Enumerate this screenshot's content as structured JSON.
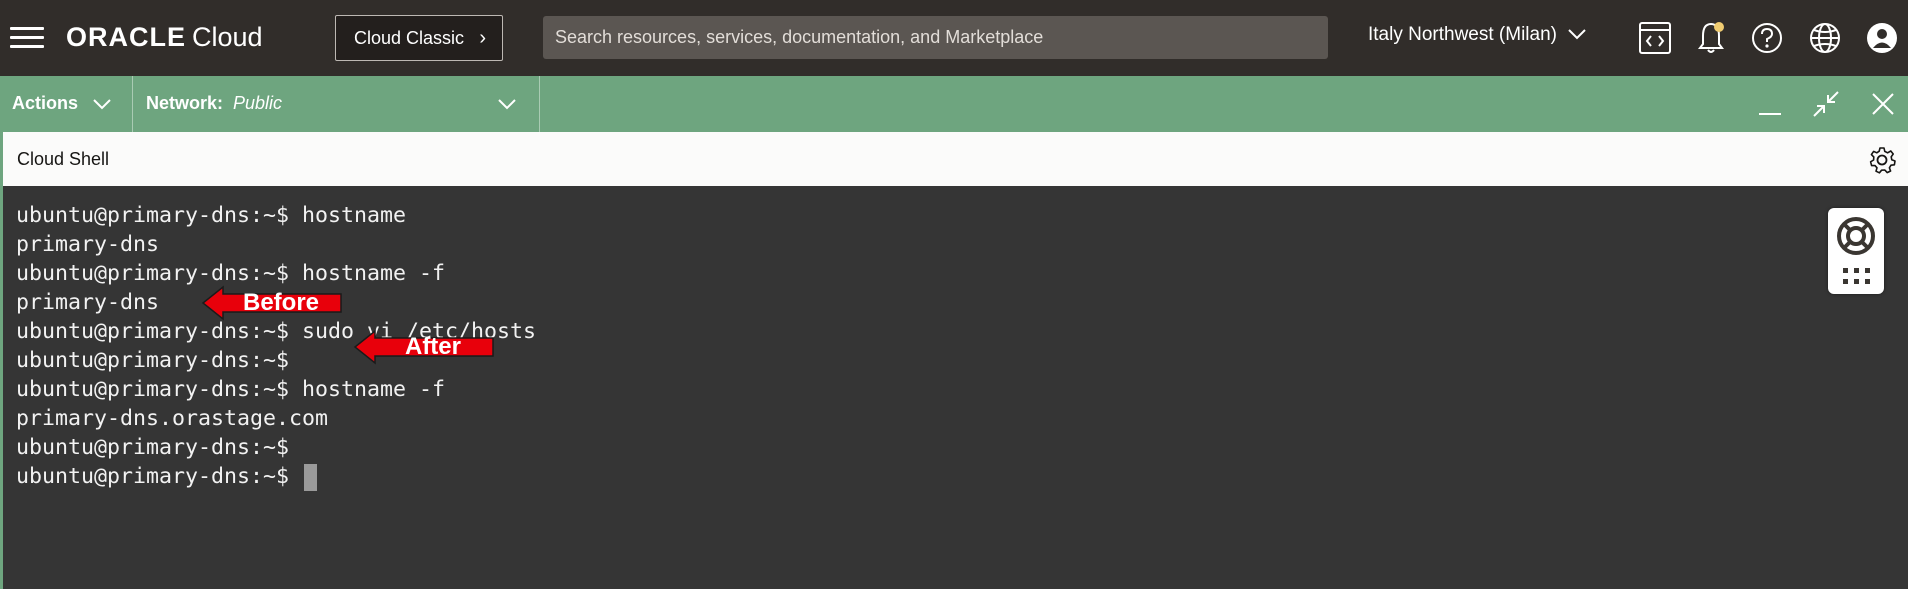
{
  "topbar": {
    "brand": "ORACLE",
    "product": "Cloud",
    "classic_button": "Cloud Classic",
    "search_placeholder": "Search resources, services, documentation, and Marketplace",
    "region": "Italy Northwest (Milan)",
    "icons": [
      "menu-icon",
      "code-editor-icon",
      "bell-icon",
      "help-icon",
      "globe-icon",
      "user-icon"
    ],
    "notification_dot_color": "#f0cc71"
  },
  "actionbar": {
    "actions_label": "Actions",
    "network_label": "Network:",
    "network_value": "Public",
    "color": "#6ea57f"
  },
  "shell": {
    "title": "Cloud Shell"
  },
  "terminal": {
    "lines": [
      "ubuntu@primary-dns:~$ hostname",
      "primary-dns",
      "ubuntu@primary-dns:~$ hostname -f",
      "primary-dns",
      "ubuntu@primary-dns:~$ sudo vi /etc/hosts",
      "ubuntu@primary-dns:~$",
      "ubuntu@primary-dns:~$ hostname -f",
      "primary-dns.orastage.com",
      "ubuntu@primary-dns:~$",
      "ubuntu@primary-dns:~$ "
    ]
  },
  "annotations": {
    "before": "Before",
    "after": "After",
    "color": "#e8000b"
  }
}
